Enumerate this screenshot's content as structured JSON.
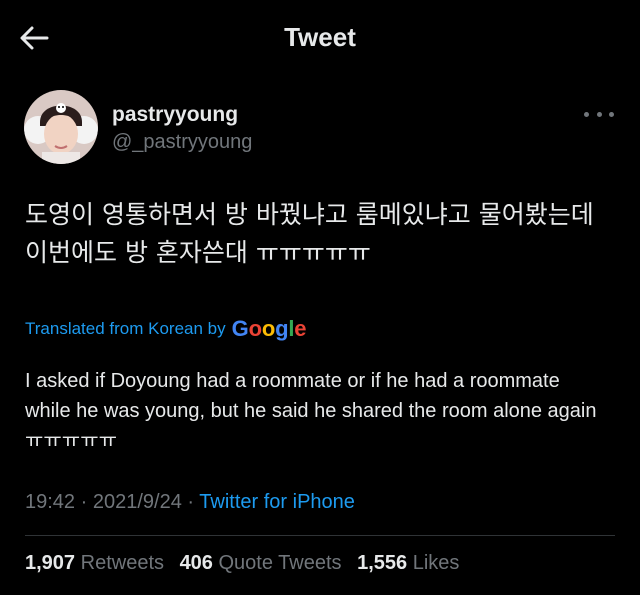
{
  "header": {
    "title": "Tweet",
    "back_icon": "arrow-left-icon"
  },
  "author": {
    "display_name": "pastryyoung",
    "handle": "@_pastryyoung",
    "more_icon": "more-dots-icon"
  },
  "tweet": {
    "text": "도영이 영통하면서 방 바꿨냐고 룸메있냐고 물어봤는데 이번에도 방 혼자쓴대 ㅠㅠㅠㅠㅠ",
    "translated_label": "Translated from Korean by",
    "translation": "I asked if Doyoung had a roommate or if he had a roommate while he was young, but he said he shared the room alone again ㅠㅠㅠㅠㅠ"
  },
  "meta": {
    "time": "19:42",
    "separator": "·",
    "date": "2021/9/24",
    "source": "Twitter for iPhone"
  },
  "stats": {
    "retweets": {
      "count": "1,907",
      "label": "Retweets"
    },
    "quotes": {
      "count": "406",
      "label": "Quote Tweets"
    },
    "likes": {
      "count": "1,556",
      "label": "Likes"
    }
  },
  "colors": {
    "background": "#000000",
    "text": "#e7e9ea",
    "muted": "#71767b",
    "link": "#1d9bf0"
  }
}
